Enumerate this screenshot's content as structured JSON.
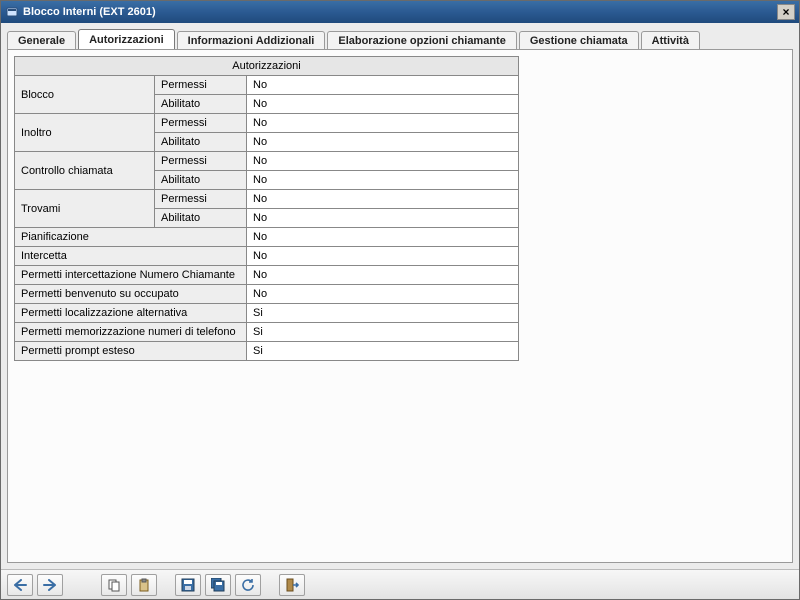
{
  "window": {
    "title": "Blocco Interni (EXT 2601)"
  },
  "tabs": [
    {
      "label": "Generale"
    },
    {
      "label": "Autorizzazioni"
    },
    {
      "label": "Informazioni Addizionali"
    },
    {
      "label": "Elaborazione opzioni chiamante"
    },
    {
      "label": "Gestione chiamata"
    },
    {
      "label": "Attività"
    }
  ],
  "active_tab": 1,
  "table": {
    "header": "Autorizzazioni",
    "grouped_rows": [
      {
        "group": "Blocco",
        "rows": [
          {
            "label": "Permessi",
            "value": "No"
          },
          {
            "label": "Abilitato",
            "value": "No"
          }
        ]
      },
      {
        "group": "Inoltro",
        "rows": [
          {
            "label": "Permessi",
            "value": "No"
          },
          {
            "label": "Abilitato",
            "value": "No"
          }
        ]
      },
      {
        "group": "Controllo chiamata",
        "rows": [
          {
            "label": "Permessi",
            "value": "No"
          },
          {
            "label": "Abilitato",
            "value": "No"
          }
        ]
      },
      {
        "group": "Trovami",
        "rows": [
          {
            "label": "Permessi",
            "value": "No"
          },
          {
            "label": "Abilitato",
            "value": "No"
          }
        ]
      }
    ],
    "single_rows": [
      {
        "label": "Pianificazione",
        "value": "No"
      },
      {
        "label": "Intercetta",
        "value": "No"
      },
      {
        "label": "Permetti intercettazione Numero Chiamante",
        "value": "No"
      },
      {
        "label": "Permetti benvenuto su occupato",
        "value": "No"
      },
      {
        "label": "Permetti localizzazione alternativa",
        "value": "Si"
      },
      {
        "label": "Permetti memorizzazione numeri di telefono",
        "value": "Si"
      },
      {
        "label": "Permetti prompt esteso",
        "value": "Si"
      }
    ]
  },
  "toolbar": {
    "prev": "Precedente",
    "next": "Successivo",
    "copy": "Copia",
    "paste": "Incolla",
    "save": "Salva",
    "save_all": "Salva tutto",
    "refresh": "Aggiorna",
    "exit": "Esci"
  }
}
